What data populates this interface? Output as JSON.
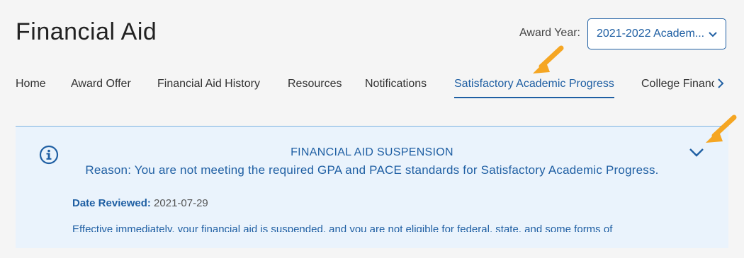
{
  "header": {
    "title": "Financial Aid",
    "award_year_label": "Award Year:",
    "award_year_value": "2021-2022 Academ..."
  },
  "tabs": [
    {
      "label": "Home"
    },
    {
      "label": "Award Offer"
    },
    {
      "label": "Financial Aid History"
    },
    {
      "label": "Resources"
    },
    {
      "label": "Notifications"
    },
    {
      "label": "Satisfactory Academic Progress",
      "active": true
    },
    {
      "label": "College Financing Plan"
    }
  ],
  "banner": {
    "title": "FINANCIAL AID SUSPENSION",
    "reason": "Reason: You are not meeting the required GPA and PACE standards for Satisfactory Academic Progress.",
    "date_label": "Date Reviewed:",
    "date_value": "2021-07-29",
    "message": "Effective immediately, your financial aid is suspended, and you are not eligible for federal, state, and some forms of"
  },
  "colors": {
    "accent": "#1f5fa3",
    "banner_bg": "#eaf3fc",
    "annotation_arrow": "#f5a623"
  },
  "icons": {
    "info": "info-circle-icon",
    "expand": "chevron-down-icon",
    "select": "chevron-down-icon",
    "tabs_next": "chevron-right-icon",
    "annotation": "arrow-annotation-icon"
  }
}
